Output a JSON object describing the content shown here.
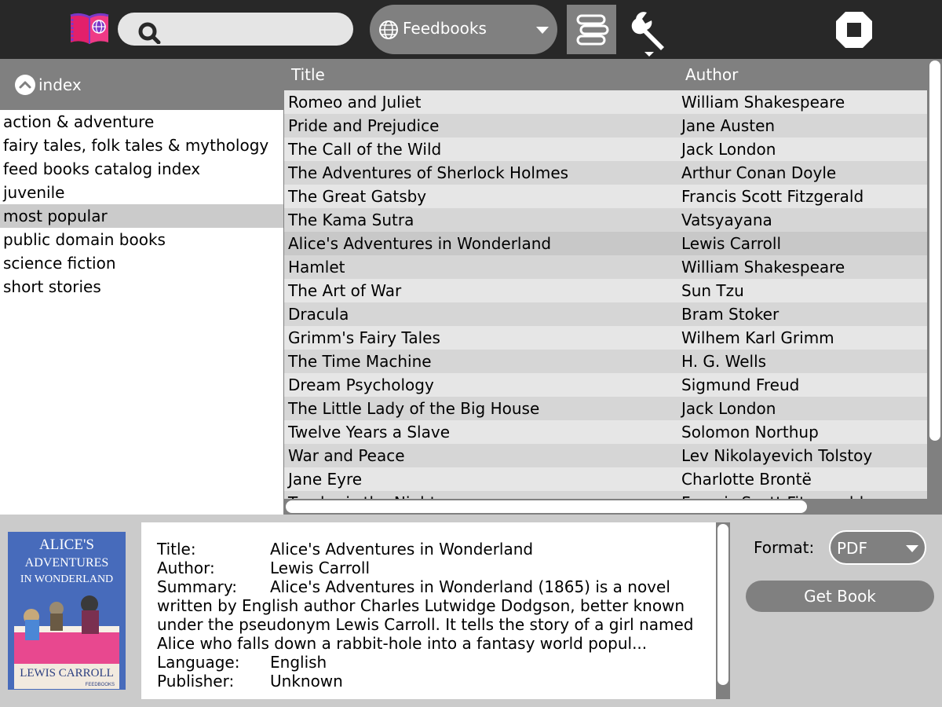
{
  "toolbar": {
    "activity_icon": "book-globe-icon",
    "search": {
      "placeholder": "",
      "value": ""
    },
    "source": {
      "label": "Feedbooks",
      "icon": "globe-icon"
    },
    "library_icon": "books-stack-icon",
    "tools_icon": "wrench-icon",
    "stop_icon": "stop-icon"
  },
  "categories": {
    "header": "index",
    "items": [
      {
        "label": "action & adventure"
      },
      {
        "label": "fairy tales, folk tales & mythology"
      },
      {
        "label": "feed books catalog index"
      },
      {
        "label": "juvenile"
      },
      {
        "label": "most popular",
        "selected": true
      },
      {
        "label": "public domain books"
      },
      {
        "label": "science fiction"
      },
      {
        "label": "short stories"
      }
    ]
  },
  "table": {
    "columns": [
      "Title",
      "Author"
    ],
    "rows": [
      {
        "title": "Romeo and Juliet",
        "author": "William Shakespeare"
      },
      {
        "title": "Pride and Prejudice",
        "author": "Jane Austen"
      },
      {
        "title": "The Call of the Wild",
        "author": "Jack London"
      },
      {
        "title": "The Adventures of Sherlock Holmes",
        "author": "Arthur Conan Doyle"
      },
      {
        "title": "The Great Gatsby",
        "author": "Francis Scott Fitzgerald"
      },
      {
        "title": "The Kama Sutra",
        "author": "Vatsyayana"
      },
      {
        "title": "Alice's Adventures in Wonderland",
        "author": "Lewis Carroll",
        "selected": true
      },
      {
        "title": "Hamlet",
        "author": "William Shakespeare"
      },
      {
        "title": "The Art of War",
        "author": "Sun Tzu"
      },
      {
        "title": "Dracula",
        "author": "Bram Stoker"
      },
      {
        "title": "Grimm's Fairy Tales",
        "author": "Wilhem Karl Grimm"
      },
      {
        "title": "The Time Machine",
        "author": "H. G. Wells"
      },
      {
        "title": "Dream Psychology",
        "author": "Sigmund Freud"
      },
      {
        "title": "The Little Lady of the Big House",
        "author": "Jack London"
      },
      {
        "title": "Twelve Years a Slave",
        "author": "Solomon Northup"
      },
      {
        "title": "War and Peace",
        "author": "Lev Nikolayevich Tolstoy"
      },
      {
        "title": "Jane Eyre",
        "author": "Charlotte Brontë"
      },
      {
        "title": "Tender is the Night",
        "author": "Francis Scott Fitzgerald"
      }
    ]
  },
  "details": {
    "title_label": "Title:",
    "title": "Alice's Adventures in Wonderland",
    "author_label": "Author:",
    "author": "Lewis Carroll",
    "summary_label": "Summary:",
    "summary": "Alice's Adventures in Wonderland (1865) is a novel written by English author Charles Lutwidge Dodgson, better known under the pseudonym Lewis Carroll. It tells the story of a girl named Alice who falls down a rabbit-hole into a fantasy world popul...",
    "language_label": "Language:",
    "language": "English",
    "publisher_label": "Publisher:",
    "publisher": "Unknown"
  },
  "cover": {
    "title_line1": "ALICE'S",
    "title_line2": "ADVENTURES",
    "title_line3": "IN WONDERLAND",
    "author": "LEWIS CARROLL",
    "publisher": "FEEDBOOKS"
  },
  "format": {
    "label": "Format:",
    "value": "PDF"
  },
  "get_book": "Get Book"
}
